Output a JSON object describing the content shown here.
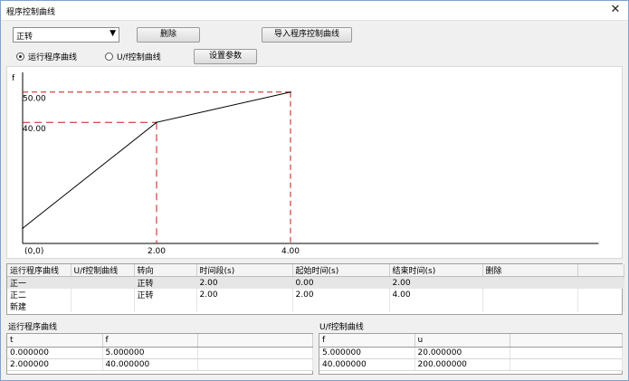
{
  "window": {
    "title": "程序控制曲线",
    "close_glyph": "✕"
  },
  "toolbar": {
    "combo_value": "正转",
    "delete_label": "删除",
    "import_label": "导入程序控制曲线"
  },
  "options": {
    "radio_run_label": "运行程序曲线",
    "radio_uf_label": "U/f控制曲线",
    "selected": "radio_run",
    "settings_label": "设置参数"
  },
  "chart_data": {
    "type": "line",
    "ylabel": "f",
    "x": [
      0,
      2,
      4
    ],
    "y": [
      5,
      40,
      50
    ],
    "origin_label": "(0,0)",
    "x_tick_labels": [
      "2.00",
      "4.00"
    ],
    "y_tick_labels": [
      "40.00",
      "50.00"
    ],
    "xlim": [
      0,
      8.6
    ],
    "ylim": [
      0,
      56.5
    ],
    "reference_color": "#c41a1a",
    "line_color": "#000000"
  },
  "segments_table": {
    "headers": [
      "运行程序曲线",
      "U/f控制曲线",
      "转向",
      "时间段(s)",
      "起始时间(s)",
      "结束时间(s)",
      "删除",
      ""
    ],
    "rows": [
      [
        "正一",
        "",
        "正转",
        "2.00",
        "0.00",
        "2.00",
        "",
        ""
      ],
      [
        "正二",
        "",
        "正转",
        "2.00",
        "2.00",
        "4.00",
        "",
        ""
      ],
      [
        "新建",
        "",
        "",
        "",
        "",
        "",
        "",
        ""
      ]
    ]
  },
  "run_curve": {
    "label": "运行程序曲线",
    "headers": [
      "t",
      "f",
      ""
    ],
    "rows": [
      [
        "0.000000",
        "5.000000",
        ""
      ],
      [
        "2.000000",
        "40.000000",
        ""
      ]
    ]
  },
  "uf_curve": {
    "label": "U/f控制曲线",
    "headers": [
      "f",
      "u",
      ""
    ],
    "rows": [
      [
        "5.000000",
        "20.000000",
        ""
      ],
      [
        "40.000000",
        "200.000000",
        ""
      ]
    ]
  }
}
